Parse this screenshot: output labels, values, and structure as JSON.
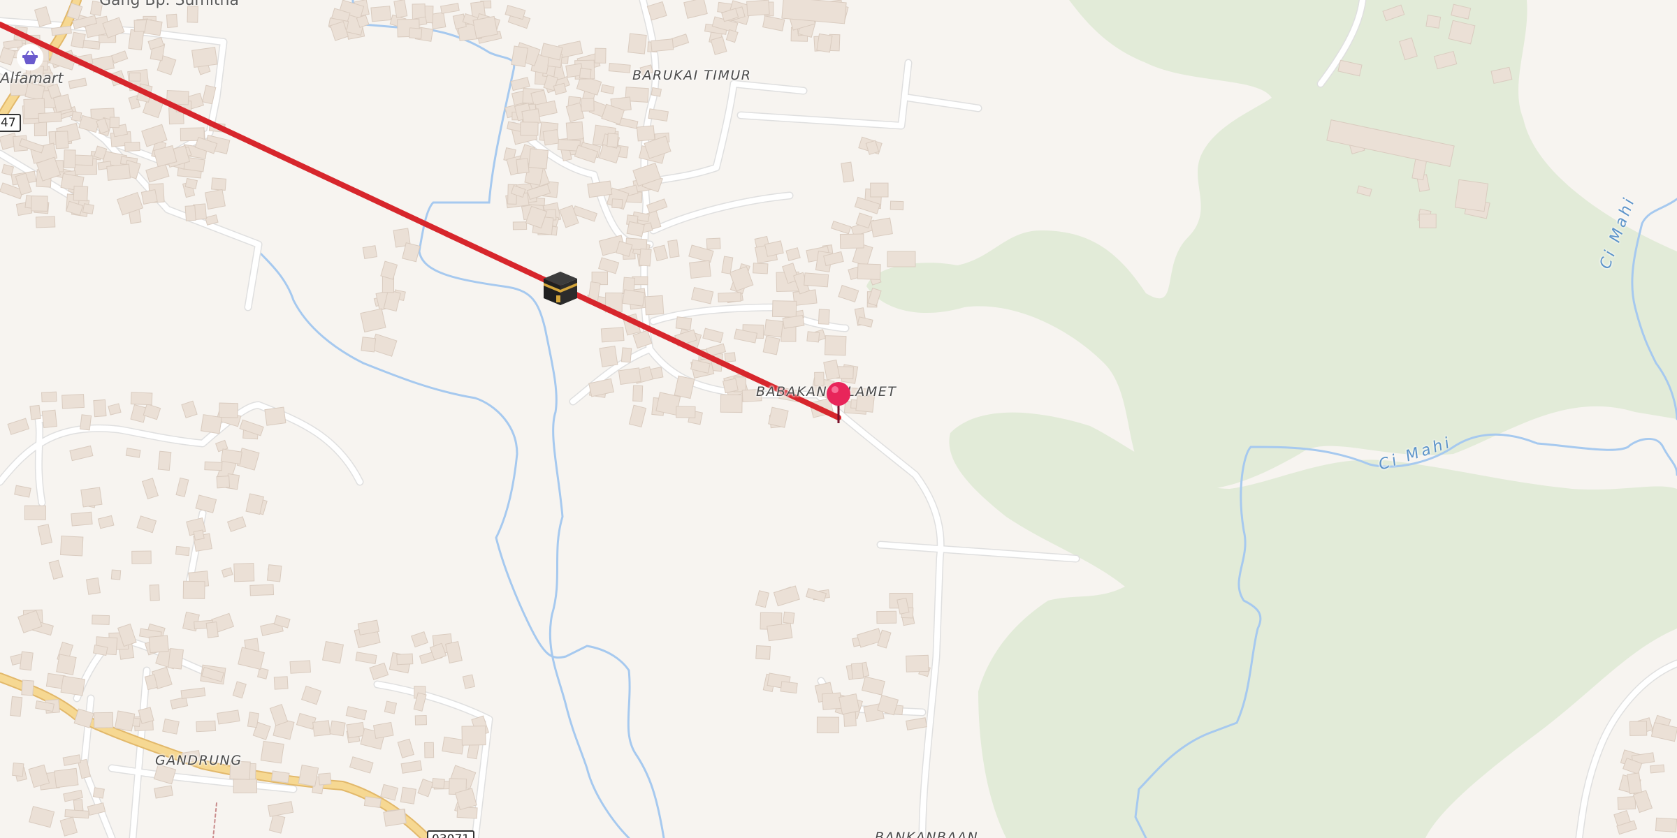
{
  "map": {
    "places": {
      "barukai_timur": "BARUKAI TIMUR",
      "babakansalamet": "BABAKANSALAMET",
      "gandrung": "GANDRUNG",
      "bankanbaan": "BANKANBAAN"
    },
    "roads": {
      "gang": "Gang Bp. Sumitha"
    },
    "rivers": {
      "ci_mahi_1": "Ci Mahi",
      "ci_mahi_2": "Ci Mahi"
    },
    "pois": {
      "alfamart": "Alfamart"
    },
    "shields": {
      "left": "47",
      "bottom": "03071"
    },
    "markers": {
      "qibla": "kaaba-icon",
      "location": "location-pin-icon"
    },
    "colors": {
      "background": "#f7f4f0",
      "forest": "#e2ebd8",
      "water": "#a6c9ef",
      "primary_road": "#f2d28a",
      "road": "#ffffff",
      "qibla_line": "#d7262c",
      "pin": "#e8255a",
      "buildings": "#e8dcd2"
    }
  }
}
